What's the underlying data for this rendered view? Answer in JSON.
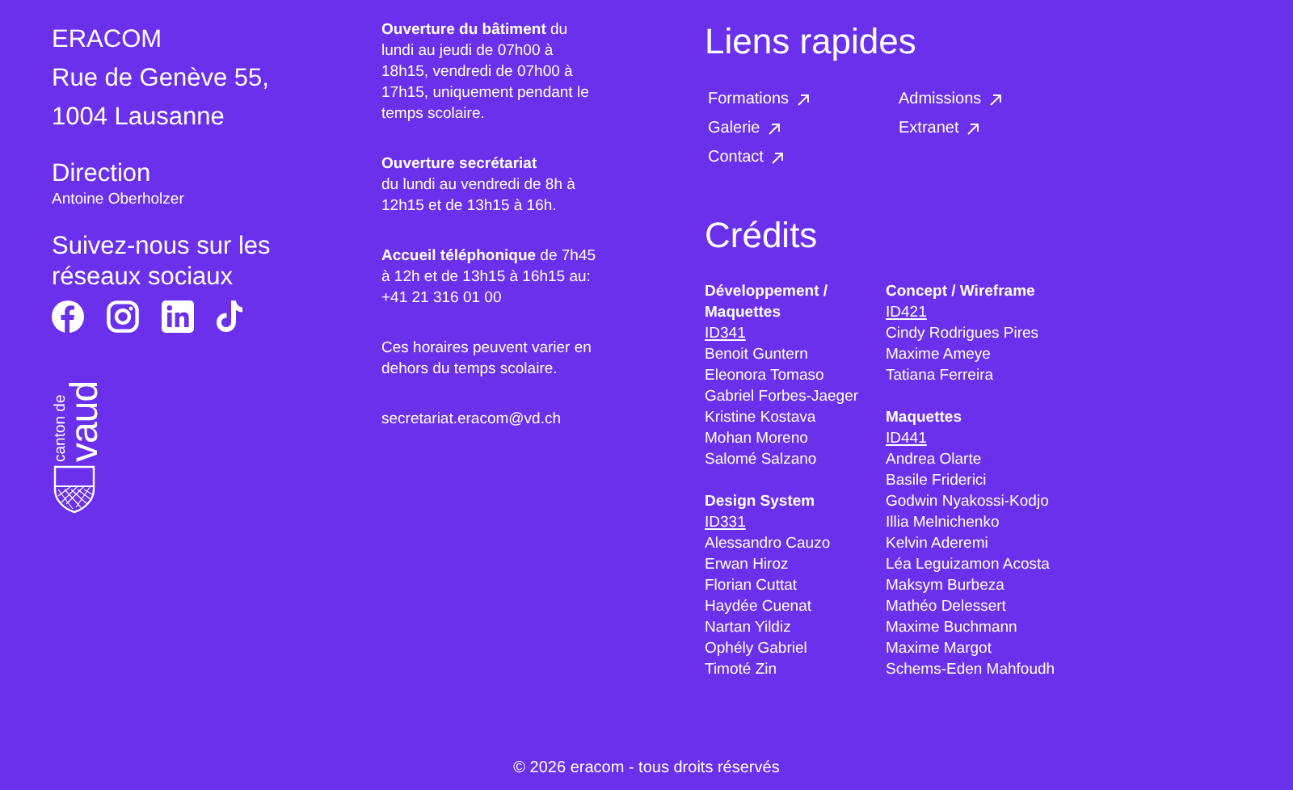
{
  "address": [
    "ERACOM",
    "Rue de Genève 55,",
    "1004 Lausanne"
  ],
  "direction": {
    "title": "Direction",
    "name": "Antoine Oberholzer"
  },
  "social": {
    "title": "Suivez-nous sur les réseaux sociaux",
    "networks": [
      {
        "kind": "facebook"
      },
      {
        "kind": "instagram"
      },
      {
        "kind": "linkedin"
      },
      {
        "kind": "tiktok"
      }
    ]
  },
  "logo": {
    "line_1": "canton de",
    "line_2": "vaud"
  },
  "hours": [
    {
      "kind": "inline",
      "lead": "Ouverture du bâtiment",
      "body": "du lundi au jeudi de 07h00 à 18h15, vendredi de 07h00 à 17h15, uniquement pendant le temps scolaire."
    },
    {
      "kind": "block",
      "lead": "Ouverture secrétariat",
      "body": "du lundi au vendredi de 8h à 12h15 et de 13h15 à 16h."
    },
    {
      "kind": "inline",
      "lead": "Accueil téléphonique",
      "body": "de 7h45 à 12h et de 13h15 à 16h15 au: +41 21 316 01 00"
    },
    {
      "kind": "plain",
      "body": "Ces horaires peuvent varier en dehors du temps scolaire."
    },
    {
      "kind": "plain",
      "body": "secretariat.eracom@vd.ch"
    }
  ],
  "quick_links": {
    "title": "Liens rapides",
    "link_columns": [
      [
        {
          "label": "Formations"
        },
        {
          "label": "Galerie"
        },
        {
          "label": "Contact"
        }
      ],
      [
        {
          "label": "Admissions"
        },
        {
          "label": "Extranet"
        }
      ]
    ]
  },
  "credits": {
    "title": "Crédits",
    "columns": [
      [
        {
          "title": "Développement / Maquettes",
          "class": "ID341",
          "names": [
            "Benoit Guntern",
            "Eleonora Tomaso",
            "Gabriel Forbes-Jaeger",
            "Kristine Kostava",
            "Mohan Moreno",
            "Salomé Salzano"
          ]
        },
        {
          "title": "Design System",
          "class": "ID331",
          "names": [
            "Alessandro Cauzo",
            "Erwan Hiroz",
            "Florian Cuttat",
            "Haydée Cuenat",
            "Nartan Yildiz",
            "Ophély Gabriel",
            "Timoté Zin"
          ]
        }
      ],
      [
        {
          "title": "Concept / Wireframe",
          "class": "ID421",
          "names": [
            "Cindy Rodrigues Pires",
            "Maxime Ameye",
            "Tatiana Ferreira"
          ]
        },
        {
          "title": "Maquettes",
          "class": "ID441",
          "names": [
            "Andrea Olarte",
            "Basile Friderici",
            "Godwin Nyakossi-Kodjo",
            "Illia Melnichenko",
            "Kelvin Aderemi",
            "Léa Leguizamon Acosta",
            "Maksym Burbeza",
            "Mathéo Delessert",
            "Maxime Buchmann",
            "Maxime Margot",
            "Schems-Eden Mahfoudh"
          ]
        }
      ]
    ]
  },
  "footer": "© 2026 eracom - tous droits réservés"
}
